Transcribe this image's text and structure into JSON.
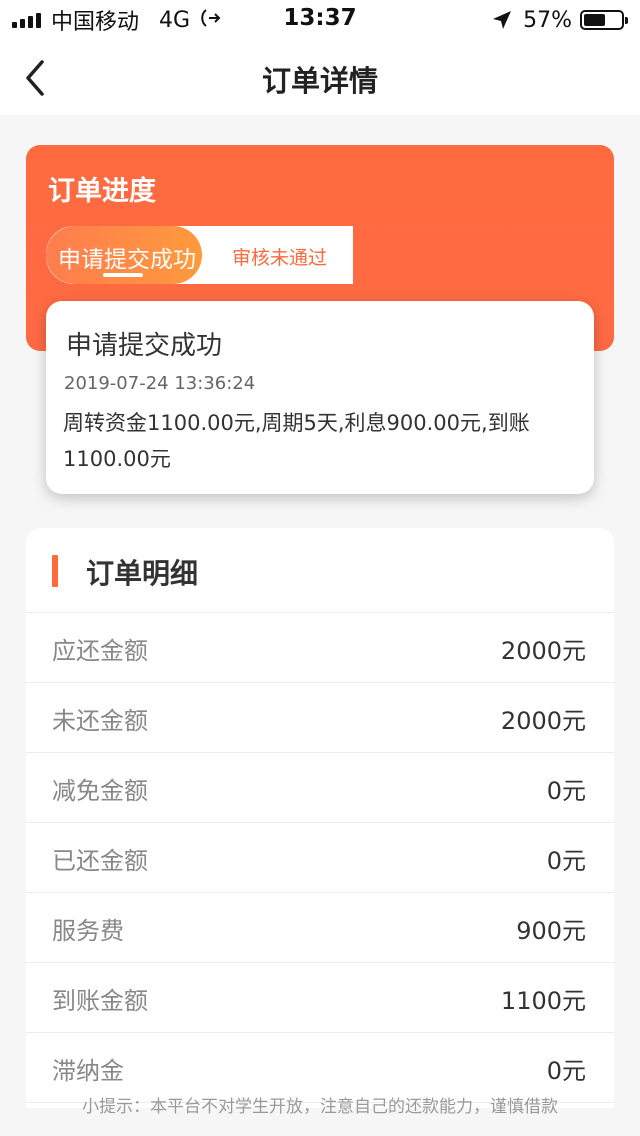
{
  "status_bar": {
    "carrier": "中国移动",
    "network": "4G",
    "time": "13:37",
    "battery_percent": "57%",
    "battery_level": 0.57
  },
  "nav": {
    "title": "订单详情",
    "back_icon": "chevron-left-icon"
  },
  "progress": {
    "title": "订单进度",
    "steps": [
      {
        "label": "申请提交成功",
        "active": true
      },
      {
        "label": "审核未通过",
        "active": false
      }
    ],
    "detail": {
      "title": "申请提交成功",
      "time": "2019-07-24 13:36:24",
      "description": "周转资金1100.00元,周期5天,利息900.00元,到账1100.00元"
    }
  },
  "order_detail": {
    "title": "订单明细",
    "rows": [
      {
        "label": "应还金额",
        "value": "2000元"
      },
      {
        "label": "未还金额",
        "value": "2000元"
      },
      {
        "label": "减免金额",
        "value": "0元"
      },
      {
        "label": "已还金额",
        "value": "0元"
      },
      {
        "label": "服务费",
        "value": "900元"
      },
      {
        "label": "到账金额",
        "value": "1100元"
      },
      {
        "label": "滞纳金",
        "value": "0元"
      }
    ]
  },
  "tip": "小提示：本平台不对学生开放，注意自己的还款能力，谨慎借款",
  "colors": {
    "accent": "#ff6a3d",
    "card_gradient_start": "#ff7d4f",
    "card_gradient_end": "#ff9a3c"
  }
}
